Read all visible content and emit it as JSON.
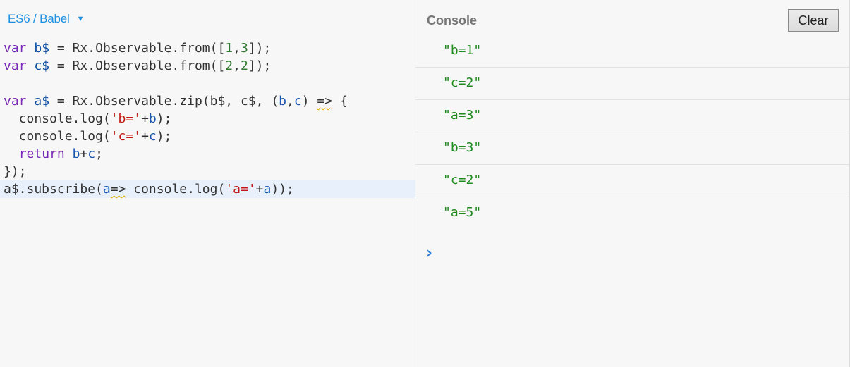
{
  "editor": {
    "language": "ES6 / Babel",
    "lines": [
      [
        {
          "t": "var",
          "c": "kw"
        },
        {
          "t": " ",
          "c": "plain"
        },
        {
          "t": "b$",
          "c": "def"
        },
        {
          "t": " = Rx.Observable.from([",
          "c": "plain"
        },
        {
          "t": "1",
          "c": "num"
        },
        {
          "t": ",",
          "c": "plain"
        },
        {
          "t": "3",
          "c": "num"
        },
        {
          "t": "]);",
          "c": "plain"
        }
      ],
      [
        {
          "t": "var",
          "c": "kw"
        },
        {
          "t": " ",
          "c": "plain"
        },
        {
          "t": "c$",
          "c": "def"
        },
        {
          "t": " = Rx.Observable.from([",
          "c": "plain"
        },
        {
          "t": "2",
          "c": "num"
        },
        {
          "t": ",",
          "c": "plain"
        },
        {
          "t": "2",
          "c": "num"
        },
        {
          "t": "]);",
          "c": "plain"
        }
      ],
      [],
      [
        {
          "t": "var",
          "c": "kw"
        },
        {
          "t": " ",
          "c": "plain"
        },
        {
          "t": "a$",
          "c": "def"
        },
        {
          "t": " = Rx.Observable.zip(b$, c$, (",
          "c": "plain"
        },
        {
          "t": "b",
          "c": "vr"
        },
        {
          "t": ",",
          "c": "plain"
        },
        {
          "t": "c",
          "c": "vr"
        },
        {
          "t": ") ",
          "c": "plain"
        },
        {
          "t": "=>",
          "c": "plain",
          "s": true
        },
        {
          "t": " {",
          "c": "plain"
        }
      ],
      [
        {
          "t": "  console.log(",
          "c": "plain"
        },
        {
          "t": "'b='",
          "c": "str"
        },
        {
          "t": "+",
          "c": "plain"
        },
        {
          "t": "b",
          "c": "vr"
        },
        {
          "t": ");",
          "c": "plain"
        }
      ],
      [
        {
          "t": "  console.log(",
          "c": "plain"
        },
        {
          "t": "'c='",
          "c": "str"
        },
        {
          "t": "+",
          "c": "plain"
        },
        {
          "t": "c",
          "c": "vr"
        },
        {
          "t": ");",
          "c": "plain"
        }
      ],
      [
        {
          "t": "  ",
          "c": "plain"
        },
        {
          "t": "return",
          "c": "kw"
        },
        {
          "t": " ",
          "c": "plain"
        },
        {
          "t": "b",
          "c": "vr"
        },
        {
          "t": "+",
          "c": "plain"
        },
        {
          "t": "c",
          "c": "vr"
        },
        {
          "t": ";",
          "c": "plain"
        }
      ],
      [
        {
          "t": "});",
          "c": "plain"
        }
      ],
      [
        {
          "t": "a$.subscribe(",
          "c": "plain"
        },
        {
          "t": "a",
          "c": "vr"
        },
        {
          "t": "=>",
          "c": "plain",
          "s": true
        },
        {
          "t": " console.log(",
          "c": "plain"
        },
        {
          "t": "'a='",
          "c": "str"
        },
        {
          "t": "+",
          "c": "plain"
        },
        {
          "t": "a",
          "c": "vr"
        },
        {
          "t": "));",
          "c": "plain"
        }
      ]
    ],
    "active_line": 8
  },
  "console": {
    "title": "Console",
    "clear_label": "Clear",
    "entries": [
      "\"b=1\"",
      "\"c=2\"",
      "\"a=3\"",
      "\"b=3\"",
      "\"c=2\"",
      "\"a=5\""
    ],
    "prompt_icon": "chevron-right-icon",
    "prompt_glyph": "›"
  },
  "colors": {
    "accent": "#1e8fe0",
    "log_text": "#1f8a1f",
    "keyword": "#7a2ab8",
    "string": "#c41a16",
    "number": "#2e7a2e",
    "active_line": "#e8f1fb"
  }
}
